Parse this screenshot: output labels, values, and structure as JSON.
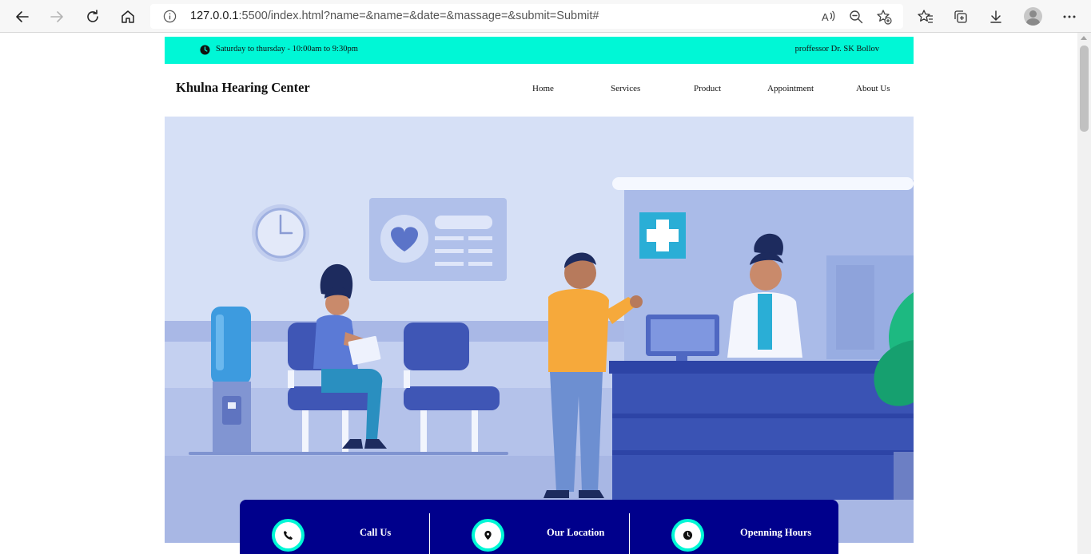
{
  "browser": {
    "url_host": "127.0.0.1",
    "url_rest": ":5500/index.html?name=&name=&date=&massage=&submit=Submit#"
  },
  "topbar": {
    "hours_text": "Saturday to thursday - 10:00am to 9:30pm",
    "doctor_text": "proffessor Dr. SK Bollov",
    "bg_color": "#00f7d6"
  },
  "header": {
    "brand": "Khulna Hearing Center",
    "nav": [
      "Home",
      "Services",
      "Product",
      "Appointment",
      "About Us"
    ]
  },
  "hero": {
    "illustration": "hospital-reception-illustration"
  },
  "infobar": {
    "bg_color": "#00008c",
    "items": [
      {
        "label": "Call Us",
        "icon": "phone-icon"
      },
      {
        "label": "Our Location",
        "icon": "location-pin-icon"
      },
      {
        "label": "Openning Hours",
        "icon": "clock-icon"
      }
    ]
  }
}
